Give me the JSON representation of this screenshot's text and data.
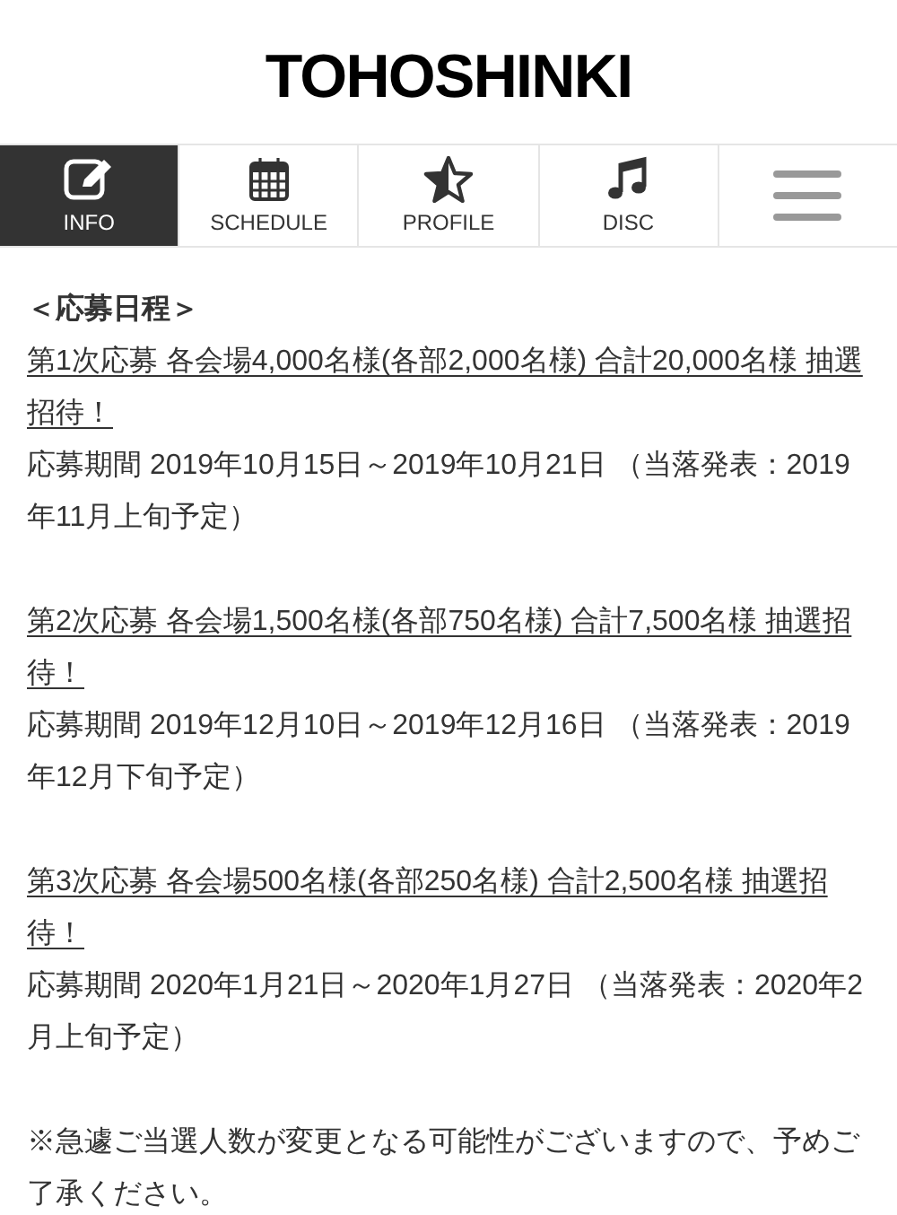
{
  "site_title": "TOHOSHINKI",
  "nav": [
    {
      "kind": "info",
      "label": "INFO",
      "selected": true
    },
    {
      "kind": "schedule",
      "label": "SCHEDULE",
      "selected": false
    },
    {
      "kind": "profile",
      "label": "PROFILE",
      "selected": false
    },
    {
      "kind": "disc",
      "label": "DISC",
      "selected": false
    },
    {
      "kind": "menu",
      "selected": false
    }
  ],
  "heading": "＜応募日程＞",
  "rounds": [
    {
      "link": "第1次応募 各会場4,000名様(各部2,000名様) 合計20,000名様 抽選招待！",
      "period": "応募期間 2019年10月15日～2019年10月21日 （当落発表：2019年11月上旬予定）"
    },
    {
      "link": "第2次応募 各会場1,500名様(各部750名様) 合計7,500名様 抽選招待！",
      "period": "応募期間 2019年12月10日～2019年12月16日 （当落発表：2019年12月下旬予定）"
    },
    {
      "link": "第3次応募 各会場500名様(各部250名様) 合計2,500名様 抽選招待！",
      "period": "応募期間 2020年1月21日～2020年1月27日 （当落発表：2020年2月上旬予定）"
    }
  ],
  "note": "※急遽ご当選人数が変更となる可能性がございますので、予めご了承ください。"
}
